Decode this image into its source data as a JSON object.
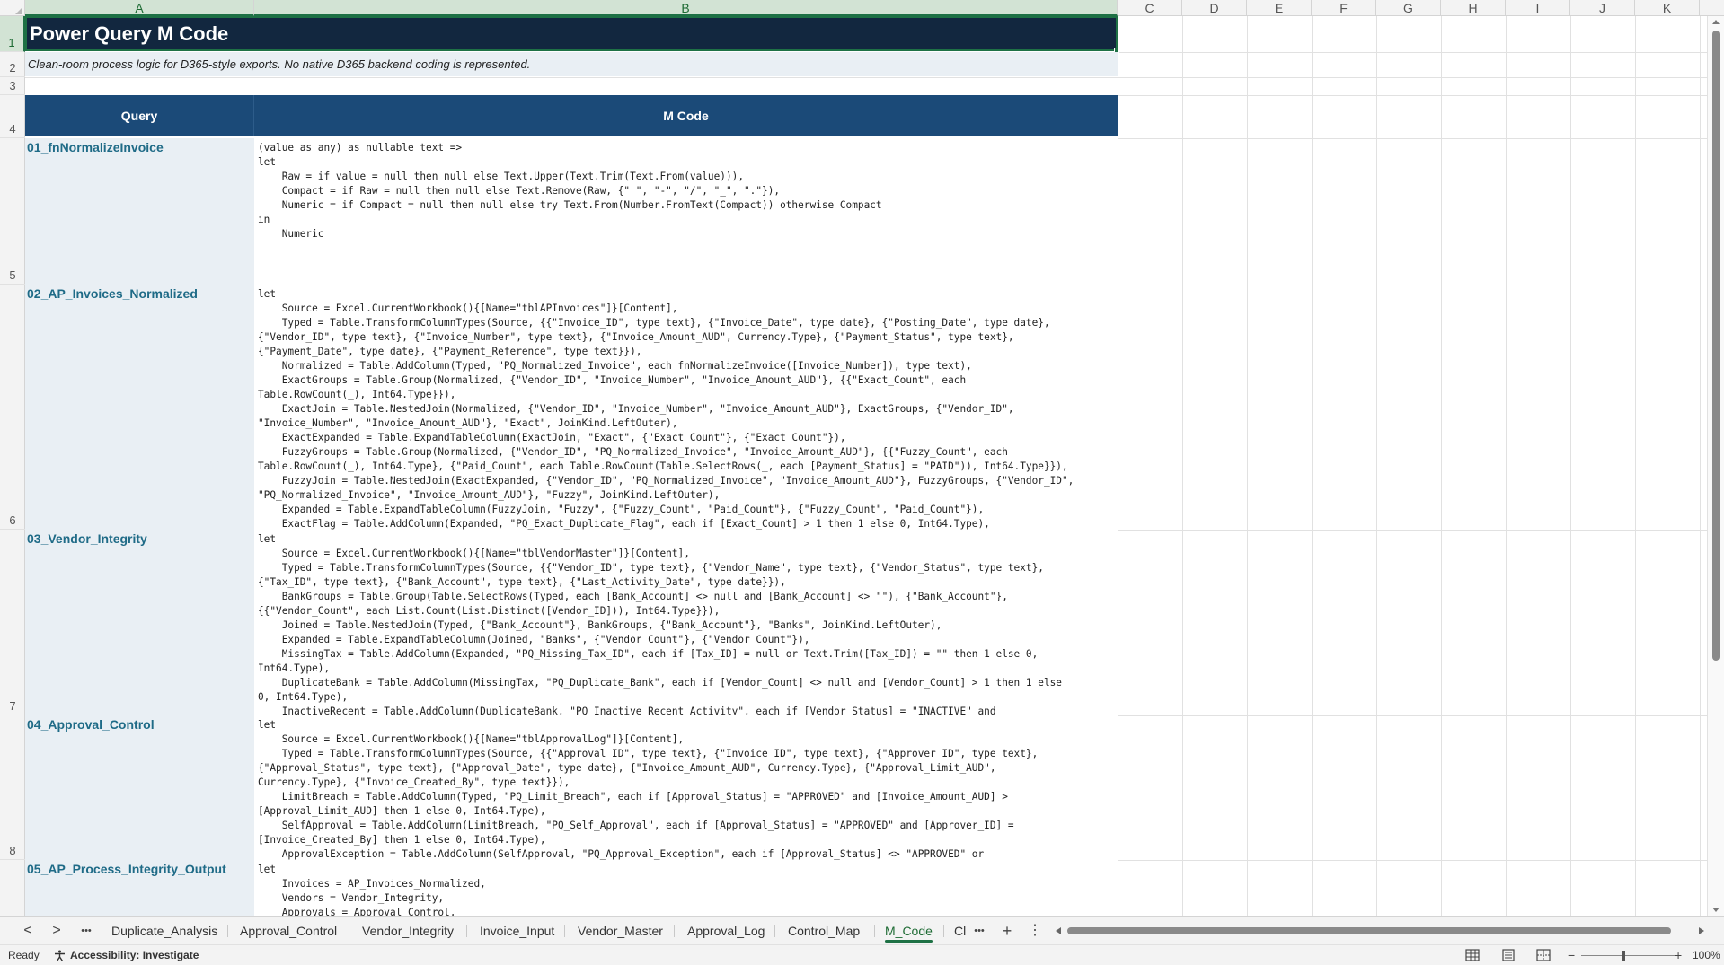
{
  "columns": [
    {
      "letter": "A",
      "active": true
    },
    {
      "letter": "B",
      "active": true
    },
    {
      "letter": "C"
    },
    {
      "letter": "D"
    },
    {
      "letter": "E"
    },
    {
      "letter": "F"
    },
    {
      "letter": "G"
    },
    {
      "letter": "H"
    },
    {
      "letter": "I"
    },
    {
      "letter": "J"
    },
    {
      "letter": "K"
    }
  ],
  "rows": [
    "1",
    "2",
    "3",
    "4",
    "5",
    "6",
    "7",
    "8"
  ],
  "sheet": {
    "title": "Power Query M Code",
    "subtitle": "Clean-room process logic for D365-style exports. No native D365 backend coding is represented.",
    "header_query": "Query",
    "header_mcode": "M Code",
    "queries": [
      {
        "name": "01_fnNormalizeInvoice",
        "code": "(value as any) as nullable text =>\nlet\n    Raw = if value = null then null else Text.Upper(Text.Trim(Text.From(value))),\n    Compact = if Raw = null then null else Text.Remove(Raw, {\" \", \"-\", \"/\", \"_\", \".\"}),\n    Numeric = if Compact = null then null else try Text.From(Number.FromText(Compact)) otherwise Compact\nin\n    Numeric"
      },
      {
        "name": "02_AP_Invoices_Normalized",
        "code": "let\n    Source = Excel.CurrentWorkbook(){[Name=\"tblAPInvoices\"]}[Content],\n    Typed = Table.TransformColumnTypes(Source, {{\"Invoice_ID\", type text}, {\"Invoice_Date\", type date}, {\"Posting_Date\", type date},\n{\"Vendor_ID\", type text}, {\"Invoice_Number\", type text}, {\"Invoice_Amount_AUD\", Currency.Type}, {\"Payment_Status\", type text},\n{\"Payment_Date\", type date}, {\"Payment_Reference\", type text}}),\n    Normalized = Table.AddColumn(Typed, \"PQ_Normalized_Invoice\", each fnNormalizeInvoice([Invoice_Number]), type text),\n    ExactGroups = Table.Group(Normalized, {\"Vendor_ID\", \"Invoice_Number\", \"Invoice_Amount_AUD\"}, {{\"Exact_Count\", each\nTable.RowCount(_), Int64.Type}}),\n    ExactJoin = Table.NestedJoin(Normalized, {\"Vendor_ID\", \"Invoice_Number\", \"Invoice_Amount_AUD\"}, ExactGroups, {\"Vendor_ID\",\n\"Invoice_Number\", \"Invoice_Amount_AUD\"}, \"Exact\", JoinKind.LeftOuter),\n    ExactExpanded = Table.ExpandTableColumn(ExactJoin, \"Exact\", {\"Exact_Count\"}, {\"Exact_Count\"}),\n    FuzzyGroups = Table.Group(Normalized, {\"Vendor_ID\", \"PQ_Normalized_Invoice\", \"Invoice_Amount_AUD\"}, {{\"Fuzzy_Count\", each\nTable.RowCount(_), Int64.Type}, {\"Paid_Count\", each Table.RowCount(Table.SelectRows(_, each [Payment_Status] = \"PAID\")), Int64.Type}}),\n    FuzzyJoin = Table.NestedJoin(ExactExpanded, {\"Vendor_ID\", \"PQ_Normalized_Invoice\", \"Invoice_Amount_AUD\"}, FuzzyGroups, {\"Vendor_ID\",\n\"PQ_Normalized_Invoice\", \"Invoice_Amount_AUD\"}, \"Fuzzy\", JoinKind.LeftOuter),\n    Expanded = Table.ExpandTableColumn(FuzzyJoin, \"Fuzzy\", {\"Fuzzy_Count\", \"Paid_Count\"}, {\"Fuzzy_Count\", \"Paid_Count\"}),\n    ExactFlag = Table.AddColumn(Expanded, \"PQ_Exact_Duplicate_Flag\", each if [Exact_Count] > 1 then 1 else 0, Int64.Type),"
      },
      {
        "name": "03_Vendor_Integrity",
        "code": "let\n    Source = Excel.CurrentWorkbook(){[Name=\"tblVendorMaster\"]}[Content],\n    Typed = Table.TransformColumnTypes(Source, {{\"Vendor_ID\", type text}, {\"Vendor_Name\", type text}, {\"Vendor_Status\", type text},\n{\"Tax_ID\", type text}, {\"Bank_Account\", type text}, {\"Last_Activity_Date\", type date}}),\n    BankGroups = Table.Group(Table.SelectRows(Typed, each [Bank_Account] <> null and [Bank_Account] <> \"\"), {\"Bank_Account\"},\n{{\"Vendor_Count\", each List.Count(List.Distinct([Vendor_ID])), Int64.Type}}),\n    Joined = Table.NestedJoin(Typed, {\"Bank_Account\"}, BankGroups, {\"Bank_Account\"}, \"Banks\", JoinKind.LeftOuter),\n    Expanded = Table.ExpandTableColumn(Joined, \"Banks\", {\"Vendor_Count\"}, {\"Vendor_Count\"}),\n    MissingTax = Table.AddColumn(Expanded, \"PQ_Missing_Tax_ID\", each if [Tax_ID] = null or Text.Trim([Tax_ID]) = \"\" then 1 else 0,\nInt64.Type),\n    DuplicateBank = Table.AddColumn(MissingTax, \"PQ_Duplicate_Bank\", each if [Vendor_Count] <> null and [Vendor_Count] > 1 then 1 else\n0, Int64.Type),\n    InactiveRecent = Table.AddColumn(DuplicateBank, \"PQ_Inactive_Recent_Activity\", each if [Vendor_Status] = \"INACTIVE\" and"
      },
      {
        "name": "04_Approval_Control",
        "code": "let\n    Source = Excel.CurrentWorkbook(){[Name=\"tblApprovalLog\"]}[Content],\n    Typed = Table.TransformColumnTypes(Source, {{\"Approval_ID\", type text}, {\"Invoice_ID\", type text}, {\"Approver_ID\", type text},\n{\"Approval_Status\", type text}, {\"Approval_Date\", type date}, {\"Invoice_Amount_AUD\", Currency.Type}, {\"Approval_Limit_AUD\",\nCurrency.Type}, {\"Invoice_Created_By\", type text}}),\n    LimitBreach = Table.AddColumn(Typed, \"PQ_Limit_Breach\", each if [Approval_Status] = \"APPROVED\" and [Invoice_Amount_AUD] >\n[Approval_Limit_AUD] then 1 else 0, Int64.Type),\n    SelfApproval = Table.AddColumn(LimitBreach, \"PQ_Self_Approval\", each if [Approval_Status] = \"APPROVED\" and [Approver_ID] =\n[Invoice_Created_By] then 1 else 0, Int64.Type),\n    ApprovalException = Table.AddColumn(SelfApproval, \"PQ_Approval_Exception\", each if [Approval_Status] <> \"APPROVED\" or"
      },
      {
        "name": "05_AP_Process_Integrity_Output",
        "code": "let\n    Invoices = AP_Invoices_Normalized,\n    Vendors = Vendor_Integrity,\n    Approvals = Approval_Control,\n    ApprovedCounts = Table.Group(Table.SelectRows(Approvals, each [Approval_Status] = \"APPROVED\"), {\"Invoice_ID\"}, {{\"Approved_Count\","
      }
    ]
  },
  "tabs": {
    "nav_prev": "<",
    "nav_next": ">",
    "more": "•••",
    "add": "+",
    "options": "⋮",
    "items": [
      {
        "label": "Duplicate_Analysis"
      },
      {
        "label": "Approval_Control"
      },
      {
        "label": "Vendor_Integrity"
      },
      {
        "label": "Invoice_Input"
      },
      {
        "label": "Vendor_Master"
      },
      {
        "label": "Approval_Log"
      },
      {
        "label": "Control_Map"
      },
      {
        "label": "M_Code",
        "active": true
      },
      {
        "label": "Cl"
      }
    ]
  },
  "status": {
    "ready": "Ready",
    "accessibility": "Accessibility: Investigate",
    "zoom_minus": "−",
    "zoom_plus": "+",
    "zoom": "100%",
    "zoom_fraction": 0.45
  },
  "colors": {
    "title_bg": "#12273f",
    "header_bg": "#1b4a78",
    "query_cell_bg": "#e9eff4",
    "query_text": "#1f6b87",
    "selection": "#1e7145"
  }
}
